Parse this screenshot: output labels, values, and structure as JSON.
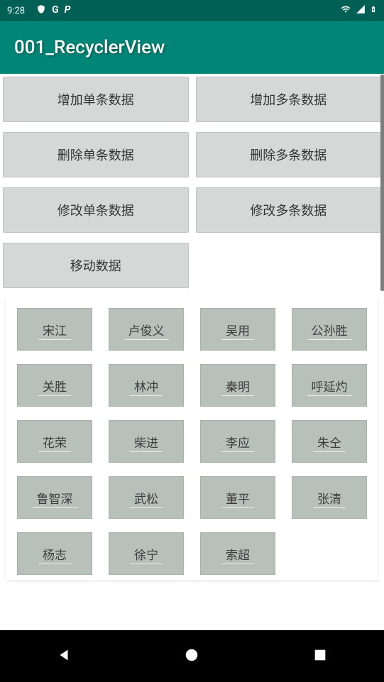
{
  "statusBar": {
    "time": "9:28",
    "iconShield": "shield",
    "iconG": "G",
    "iconP": "P"
  },
  "appTitle": "001_RecyclerView",
  "buttons": [
    "增加单条数据",
    "增加多条数据",
    "删除单条数据",
    "删除多条数据",
    "修改单条数据",
    "修改多条数据",
    "移动数据"
  ],
  "items": [
    "宋江",
    "卢俊义",
    "吴用",
    "公孙胜",
    "关胜",
    "林冲",
    "秦明",
    "呼延灼",
    "花荣",
    "柴进",
    "李应",
    "朱仝",
    "鲁智深",
    "武松",
    "董平",
    "张清",
    "杨志",
    "徐宁",
    "索超"
  ]
}
